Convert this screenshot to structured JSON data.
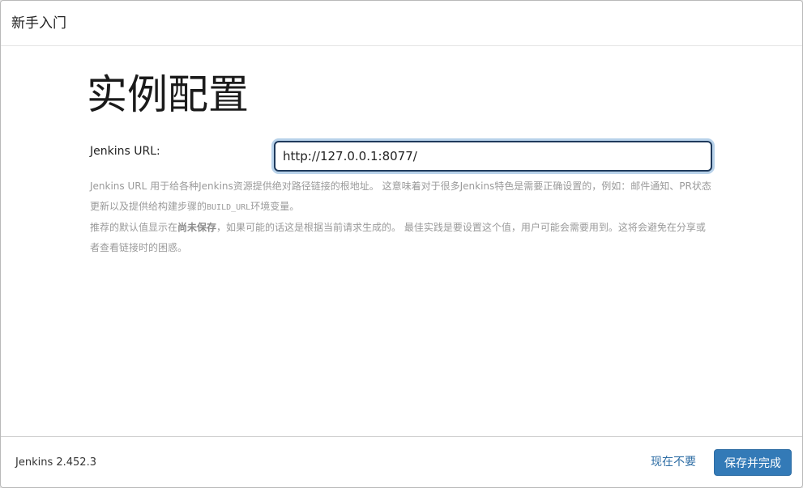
{
  "header": {
    "title": "新手入门"
  },
  "main": {
    "page_title": "实例配置",
    "url_label": "Jenkins URL:",
    "url_value": "http://127.0.0.1:8077/",
    "help_line1_part1": "Jenkins URL 用于给各种Jenkins资源提供绝对路径链接的根地址。 这意味着对于很多Jenkins特色是需要正确设置的，例如：邮件通知、PR状态更新以及提供给构建步骤的",
    "help_line1_code": "BUILD_URL",
    "help_line1_part2": "环境变量。",
    "help_line2_part1": "推荐的默认值显示在",
    "help_line2_strong": "尚未保存",
    "help_line2_part2": "，如果可能的话这是根据当前请求生成的。 最佳实践是要设置这个值，用户可能会需要用到。这将会避免在分享或者查看链接时的困惑。"
  },
  "footer": {
    "version": "Jenkins 2.452.3",
    "skip_label": "现在不要",
    "save_label": "保存并完成"
  },
  "colors": {
    "primary_button": "#337ab7",
    "link": "#2e6da4",
    "input_focus_border": "#1f3a5c",
    "input_focus_glow": "#b8d2ea"
  }
}
